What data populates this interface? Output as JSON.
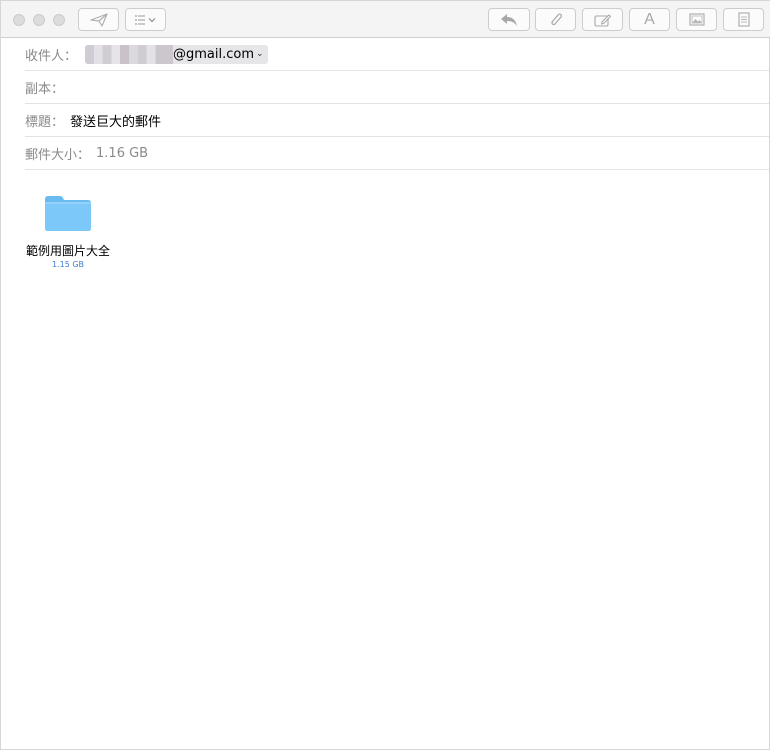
{
  "toolbar": {
    "send_icon": "paper-plane-icon",
    "format_icon": "list-format-icon",
    "reply_icon": "reply-arrow-icon",
    "attach_icon": "paperclip-icon",
    "markup_icon": "markup-pen-icon",
    "font_label": "A",
    "photo_icon": "photo-browser-icon",
    "stationery_icon": "stationery-icon"
  },
  "header": {
    "to_label": "收件人：",
    "to_address_suffix": "@gmail.com",
    "cc_label": "副本：",
    "subject_label": "標題：",
    "subject_value": "發送巨大的郵件",
    "size_label": "郵件大小：",
    "size_value": "1.16 GB"
  },
  "attachment": {
    "name": "範例用圖片大全",
    "size": "1.15 GB",
    "icon": "folder-icon",
    "size_color": "#3b7fd6"
  },
  "colors": {
    "folder_fill": "#7cc8f8",
    "folder_tab": "#6abcf0"
  }
}
